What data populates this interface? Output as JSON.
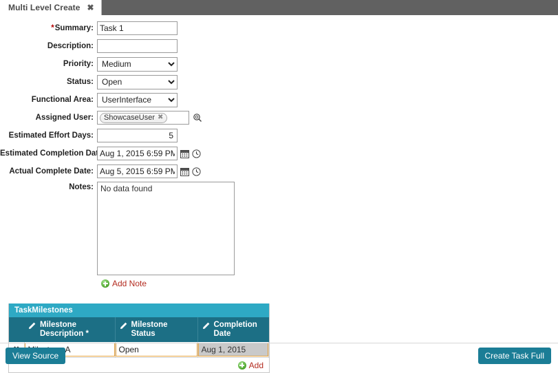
{
  "tab": {
    "label": "Multi Level Create",
    "close_icon": "close-icon"
  },
  "form": {
    "fields": [
      {
        "label": "Summary:",
        "required": true,
        "type": "text",
        "value": "Task 1"
      },
      {
        "label": "Description:",
        "required": false,
        "type": "text",
        "value": ""
      },
      {
        "label": "Priority:",
        "required": false,
        "type": "select",
        "value": "Medium"
      },
      {
        "label": "Status:",
        "required": false,
        "type": "select",
        "value": "Open"
      },
      {
        "label": "Functional Area:",
        "required": false,
        "type": "select",
        "value": "UserInterface"
      },
      {
        "label": "Assigned User:",
        "required": false,
        "type": "token",
        "value": "ShowcaseUser"
      },
      {
        "label": "Estimated Effort Days:",
        "required": false,
        "type": "number",
        "value": "5"
      },
      {
        "label": "Estimated Completion Date:",
        "required": false,
        "type": "datetime",
        "value": "Aug 1, 2015 6:59 PM"
      },
      {
        "label": "Actual Complete Date:",
        "required": false,
        "type": "datetime",
        "value": "Aug 5, 2015 6:59 PM"
      }
    ],
    "priority_options": [
      "Medium"
    ],
    "status_options": [
      "Open"
    ],
    "functional_area_options": [
      "UserInterface"
    ],
    "notes": {
      "label": "Notes:",
      "content": "No data found",
      "add_link": "Add Note",
      "add_icon": "plus-circle-icon"
    }
  },
  "grid": {
    "title": "TaskMilestones",
    "columns": [
      {
        "label": "Milestone Description *",
        "icon": "pencil-icon"
      },
      {
        "label": "Milestone Status",
        "icon": "pencil-icon"
      },
      {
        "label": "Completion Date",
        "icon": "pencil-icon"
      }
    ],
    "rows": [
      {
        "delete_icon": "delete-row-icon",
        "description": "Milestone A",
        "status": "Open",
        "completion_date": "Aug 1, 2015"
      }
    ],
    "add_link": "Add",
    "add_icon": "plus-circle-icon"
  },
  "footer": {
    "view_source_label": "View Source",
    "create_task_label": "Create Task Full"
  },
  "colors": {
    "tabbar_bg": "#616161",
    "grid_title_bg": "#2ea9c4",
    "grid_header_bg": "#1c6f85",
    "button_bg": "#1b7d96",
    "required_star": "#b50000",
    "link_text": "#b32b1f",
    "cell_border": "#e8a33d",
    "readonly_cell_bg": "#c9c9c9"
  }
}
